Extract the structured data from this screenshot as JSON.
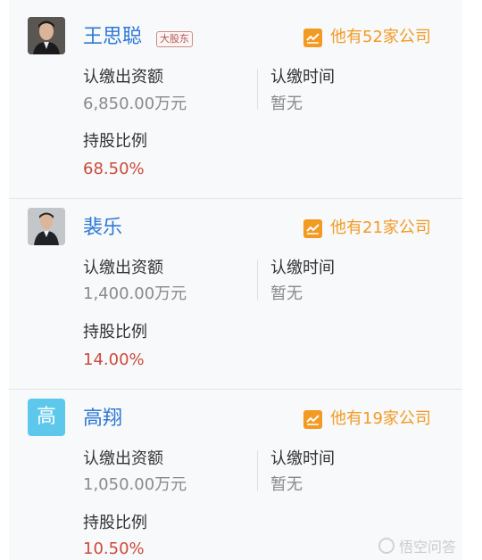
{
  "shareholders": [
    {
      "name": "王思聪",
      "badge": "大股东",
      "avatar_icon": "person-photo-icon",
      "company_count_text": "他有52家公司",
      "capital_label": "认缴出资额",
      "capital_value": "6,850.00万元",
      "time_label": "认缴时间",
      "time_value": "暂无",
      "ratio_label": "持股比例",
      "ratio_value": "68.50%"
    },
    {
      "name": "裴乐",
      "avatar_icon": "person-photo-icon",
      "company_count_text": "他有21家公司",
      "capital_label": "认缴出资额",
      "capital_value": "1,400.00万元",
      "time_label": "认缴时间",
      "time_value": "暂无",
      "ratio_label": "持股比例",
      "ratio_value": "14.00%"
    },
    {
      "name": "高翔",
      "avatar_letter": "高",
      "company_count_text": "他有19家公司",
      "capital_label": "认缴出资额",
      "capital_value": "1,050.00万元",
      "time_label": "认缴时间",
      "time_value": "暂无",
      "ratio_label": "持股比例",
      "ratio_value": "10.50%"
    }
  ],
  "watermark": {
    "text": "悟空问答"
  },
  "colors": {
    "name_blue": "#2f78d6",
    "accent_orange": "#f39a23",
    "percent_red": "#cc4a3a",
    "avatar_cyan": "#5ec8ec"
  }
}
